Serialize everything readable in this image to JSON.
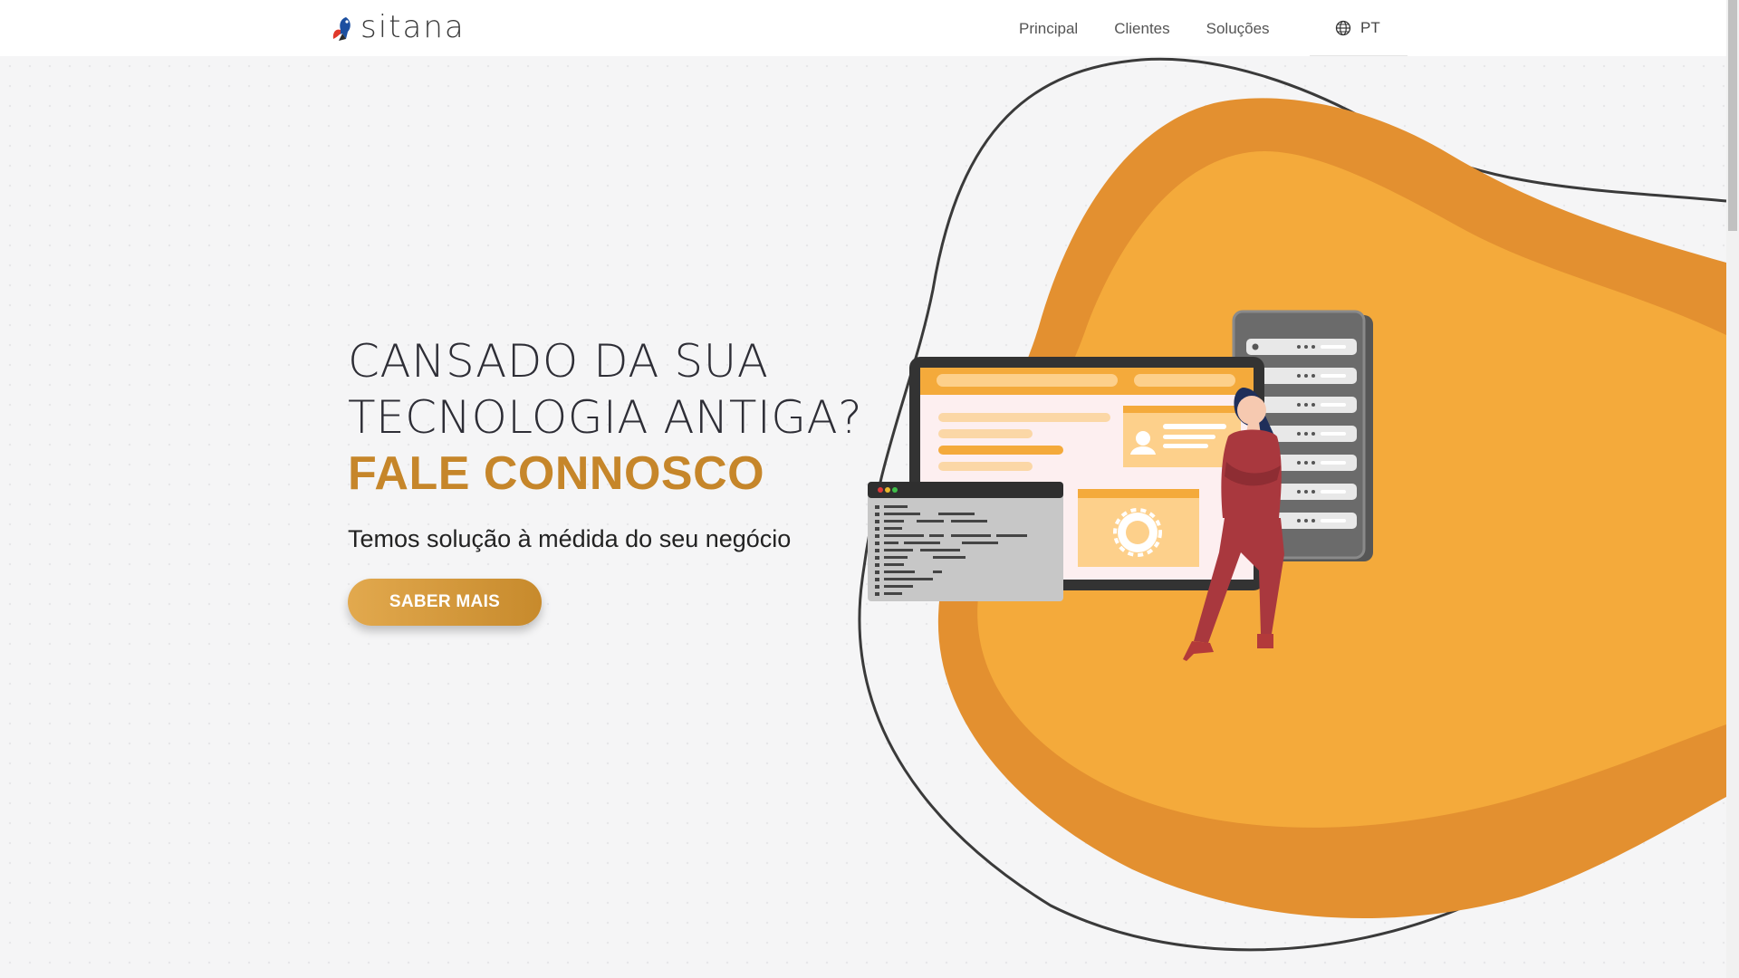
{
  "brand": {
    "name": "sitana"
  },
  "nav": {
    "items": [
      {
        "label": "Principal"
      },
      {
        "label": "Clientes"
      },
      {
        "label": "Soluções"
      }
    ],
    "language": "PT"
  },
  "hero": {
    "title_line1": "CANSADO DA SUA",
    "title_line2": "TECNOLOGIA ANTIGA?",
    "title_accent": "FALE CONNOSCO",
    "subtitle": "Temos solução à médida do seu negócio",
    "cta_label": "SABER MAIS"
  },
  "colors": {
    "accent": "#c6862a",
    "blob_light": "#f4aa3b",
    "blob_dark": "#e39030",
    "background": "#f5f5f6"
  },
  "icons": [
    "globe-icon",
    "brand-logo-icon"
  ]
}
